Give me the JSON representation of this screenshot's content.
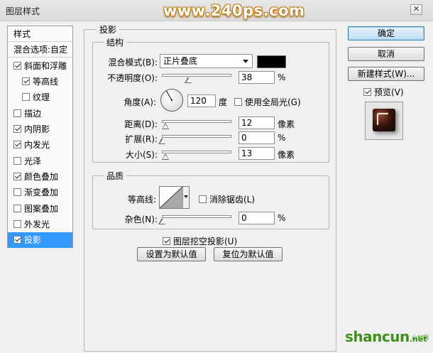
{
  "window": {
    "title": "图层样式",
    "watermark": "www.240ps.com",
    "close_label": "✕"
  },
  "stylelist": {
    "header": "样式",
    "blend_options": "混合选项:自定",
    "items": [
      {
        "label": "斜面和浮雕",
        "checked": true
      },
      {
        "label": "等高线",
        "checked": true
      },
      {
        "label": "纹理",
        "checked": false
      },
      {
        "label": "描边",
        "checked": false
      },
      {
        "label": "内阴影",
        "checked": true
      },
      {
        "label": "内发光",
        "checked": true
      },
      {
        "label": "光泽",
        "checked": false
      },
      {
        "label": "颜色叠加",
        "checked": true
      },
      {
        "label": "渐变叠加",
        "checked": false
      },
      {
        "label": "图案叠加",
        "checked": false
      },
      {
        "label": "外发光",
        "checked": false
      },
      {
        "label": "投影",
        "checked": true,
        "selected": true
      }
    ]
  },
  "panel": {
    "title": "投影",
    "structure": {
      "title": "结构",
      "blend_mode_label": "混合模式(B):",
      "blend_mode_value": "正片叠底",
      "color": "#000000",
      "opacity_label": "不透明度(O):",
      "opacity_value": "38",
      "opacity_unit": "%",
      "opacity_level": 0.38,
      "angle_label": "角度(A):",
      "angle_value": "120",
      "angle_unit": "度",
      "global_light_label": "使用全局光(G)",
      "global_light_checked": false,
      "distance_label": "距离(D):",
      "distance_value": "12",
      "distance_unit": "像素",
      "distance_level": 0.05,
      "spread_label": "扩展(R):",
      "spread_value": "0",
      "spread_unit": "%",
      "spread_level": 0.0,
      "size_label": "大小(S):",
      "size_value": "13",
      "size_unit": "像素",
      "size_level": 0.05
    },
    "quality": {
      "title": "品质",
      "contour_label": "等高线:",
      "antialias_label": "消除锯齿(L)",
      "antialias_checked": false,
      "noise_label": "杂色(N):",
      "noise_value": "0",
      "noise_unit": "%",
      "noise_level": 0.0
    },
    "knockout_label": "图层挖空投影(U)",
    "knockout_checked": true,
    "make_default": "设置为默认值",
    "reset_default": "复位为默认值"
  },
  "buttons": {
    "ok": "确定",
    "cancel": "取消",
    "new_style": "新建样式(W)...",
    "preview_label": "预览(V)",
    "preview_checked": true
  },
  "footer": {
    "logo_main": "shancun",
    "logo_sub": ".net",
    "logo_small": "山村网"
  },
  "colors": {
    "selection": "#3399ff",
    "watermark_outline": "#c07a10",
    "logo_green": "#3f8f1e"
  }
}
